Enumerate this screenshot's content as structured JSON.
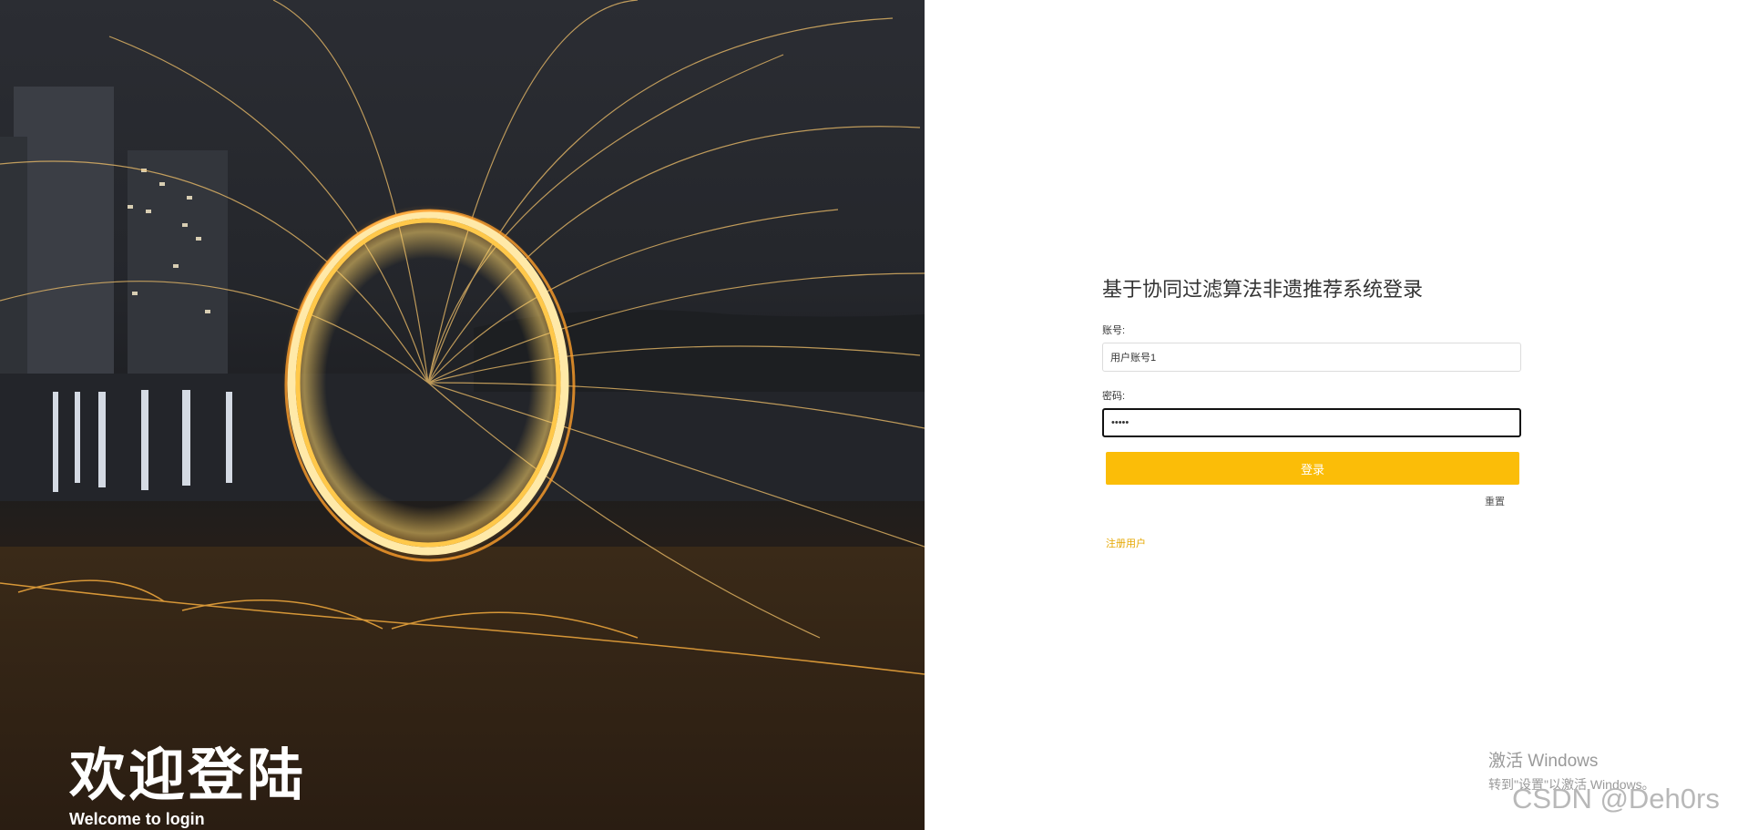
{
  "hero": {
    "title": "欢迎登陆",
    "subtitle": "Welcome to login"
  },
  "login": {
    "title": "基于协同过滤算法非遗推荐系统登录",
    "account_label": "账号:",
    "account_value": "用户账号1",
    "password_label": "密码:",
    "password_value": "•••••",
    "login_button": "登录",
    "reset_link": "重置",
    "register_link": "注册用户"
  },
  "watermark": {
    "activate_line1": "激活 Windows",
    "activate_line2": "转到\"设置\"以激活 Windows。",
    "csdn": "CSDN @Deh0rs"
  },
  "colors": {
    "accent": "#fbbd08",
    "register_link": "#e6a700"
  },
  "icons": {
    "text_cursor": "i-beam-cursor-icon"
  }
}
